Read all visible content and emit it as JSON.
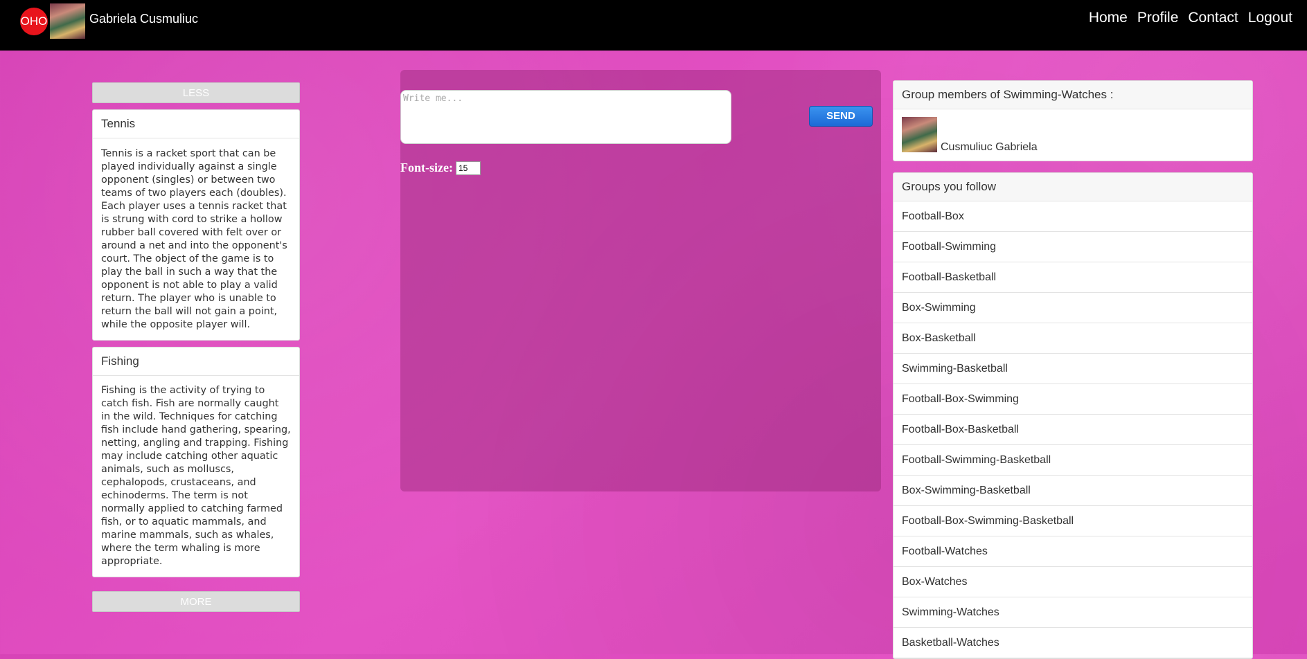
{
  "header": {
    "logo_text": "OHO",
    "user_name": "Gabriela Cusmuliuc",
    "nav": [
      "Home",
      "Profile",
      "Contact",
      "Logout"
    ]
  },
  "left": {
    "less_label": "LESS",
    "more_label": "MORE",
    "cards": [
      {
        "title": "Tennis",
        "text": "Tennis is a racket sport that can be played individually against a single opponent (singles) or between two teams of two players each (doubles). Each player uses a tennis racket that is strung with cord to strike a hollow rubber ball covered with felt over or around a net and into the opponent's court. The object of the game is to play the ball in such a way that the opponent is not able to play a valid return. The player who is unable to return the ball will not gain a point, while the opposite player will."
      },
      {
        "title": "Fishing",
        "text": "Fishing is the activity of trying to catch fish. Fish are normally caught in the wild. Techniques for catching fish include hand gathering, spearing, netting, angling and trapping. Fishing may include catching other aquatic animals, such as molluscs, cephalopods, crustaceans, and echinoderms. The term is not normally applied to catching farmed fish, or to aquatic mammals, and marine mammals, such as whales, where the term whaling is more appropriate."
      }
    ]
  },
  "chat": {
    "placeholder": "Write me...",
    "send_label": "SEND",
    "font_size_label": "Font-size:",
    "font_size_value": "15"
  },
  "members": {
    "title": "Group members of Swimming-Watches :",
    "names": [
      "Cusmuliuc Gabriela"
    ]
  },
  "groups": {
    "title": "Groups you follow",
    "items": [
      "Football-Box",
      "Football-Swimming",
      "Football-Basketball",
      "Box-Swimming",
      "Box-Basketball",
      "Swimming-Basketball",
      "Football-Box-Swimming",
      "Football-Box-Basketball",
      "Football-Swimming-Basketball",
      "Box-Swimming-Basketball",
      "Football-Box-Swimming-Basketball",
      "Football-Watches",
      "Box-Watches",
      "Swimming-Watches",
      "Basketball-Watches"
    ]
  },
  "colors": {
    "background": "#e04bc0",
    "topbar": "#000000",
    "logo": "#e8141c",
    "send_button": "#2a7fe4"
  }
}
